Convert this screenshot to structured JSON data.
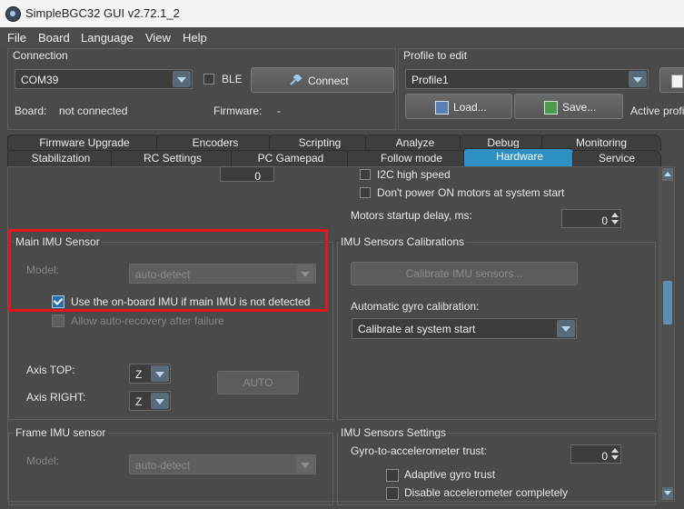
{
  "window": {
    "title": "SimpleBGC32 GUI v2.72.1_2"
  },
  "menu": [
    "File",
    "Board",
    "Language",
    "View",
    "Help"
  ],
  "connection": {
    "title": "Connection",
    "port": "COM39",
    "ble_label": "BLE",
    "connect_label": "Connect",
    "board_label": "Board:",
    "board_value": "not connected",
    "firmware_label": "Firmware:",
    "firmware_value": "-"
  },
  "profile": {
    "title": "Profile to edit",
    "selected": "Profile1",
    "load_label": "Load...",
    "save_label": "Save...",
    "active_label": "Active profi"
  },
  "tabs_row1": [
    "Firmware Upgrade",
    "Encoders",
    "Scripting",
    "Analyze",
    "Debug",
    "Monitoring"
  ],
  "tabs_row2": [
    "Stabilization",
    "RC Settings",
    "PC Gamepad",
    "Follow mode",
    "Hardware",
    "Service"
  ],
  "active_tab": "Hardware",
  "top_left": {
    "spin_value": "0"
  },
  "top_right": {
    "i2c_label": "I2C high speed",
    "dont_power_label": "Don't power ON motors at system start",
    "startup_delay_label": "Motors startup delay, ms:",
    "startup_delay_value": "0"
  },
  "main_imu": {
    "title": "Main IMU Sensor",
    "model_label": "Model:",
    "model_value": "auto-detect",
    "use_onboard_label": "Use the on-board IMU if main IMU is not detected",
    "use_onboard_checked": true,
    "allow_recovery_label": "Allow auto-recovery after failure",
    "axis_top_label": "Axis TOP:",
    "axis_top_value": "Z",
    "axis_right_label": "Axis RIGHT:",
    "axis_right_value": "Z",
    "auto_label": "AUTO"
  },
  "imu_calibrations": {
    "title": "IMU Sensors Calibrations",
    "calibrate_label": "Calibrate IMU sensors...",
    "auto_gyro_label": "Automatic gyro calibration:",
    "auto_gyro_value": "Calibrate at system start"
  },
  "frame_imu": {
    "title": "Frame IMU sensor",
    "model_label": "Model:",
    "model_value": "auto-detect"
  },
  "imu_settings": {
    "title": "IMU Sensors Settings",
    "trust_label": "Gyro-to-accelerometer trust:",
    "trust_value": "0",
    "adaptive_label": "Adaptive gyro trust",
    "disable_acc_label": "Disable accelerometer completely"
  },
  "highlight_color": "#e8141c",
  "accent_color": "#2d8fc2"
}
